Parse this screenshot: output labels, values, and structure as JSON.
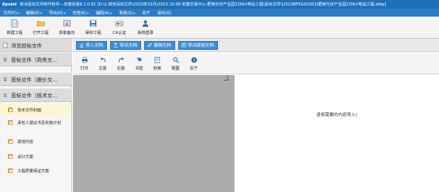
{
  "window": {
    "logo": "Epoint",
    "title": "新点投标文件制作软件---安徽省版6.2.0.61   [D:\\1.商务投标文件\\2023年10月\\2023.10.08-安徽交易中心-肥西光伏产业园220kV电站工程\\投标文件\\[2023BFEG01953]肥西光伏产业园220kV电站工程.etbp]"
  },
  "menu": {
    "items": [
      {
        "label": "文件(F)",
        "has_arrow": true
      },
      {
        "label": "编辑(E)",
        "has_arrow": true
      },
      {
        "label": "导出(O)",
        "has_arrow": true
      },
      {
        "label": "检查(K)",
        "has_arrow": true
      },
      {
        "label": "辅助(A)",
        "has_arrow": true
      },
      {
        "label": "系统(S)",
        "has_arrow": true
      },
      {
        "label": "关于",
        "has_arrow": false
      },
      {
        "label": "退出(Q)",
        "has_arrow": false
      }
    ]
  },
  "toolbar": {
    "buttons": [
      {
        "label": "新建工程",
        "icon": "new-project-icon"
      },
      {
        "label": "打开工程",
        "icon": "open-project-icon"
      },
      {
        "label": "获取备份",
        "icon": "get-backup-icon"
      },
      {
        "label": "保存工程",
        "icon": "save-project-icon"
      },
      {
        "label": "CA认证",
        "icon": "ca-certificate-icon"
      },
      {
        "label": "系统登录",
        "icon": "system-login-icon"
      }
    ]
  },
  "left_panel": {
    "sections": [
      {
        "label": "浏览招标文件"
      },
      {
        "label": "投标文件（商务文..."
      },
      {
        "label": "投标文件（报价文..."
      },
      {
        "label": "投标文件（技术文..."
      }
    ],
    "tech_items": [
      {
        "label": "技术文件封面",
        "active": true
      },
      {
        "label": "承包人建议书及实施计划",
        "active": false
      },
      {
        "label": "其他内容",
        "active": false
      },
      {
        "label": "设计方案",
        "active": false
      },
      {
        "label": "工程质量保证方案",
        "active": false
      }
    ]
  },
  "action_bar": {
    "buttons": [
      {
        "label": "导入文档",
        "icon": "import-icon"
      },
      {
        "label": "导出文档",
        "icon": "export-icon"
      },
      {
        "label": "编辑文档",
        "icon": "edit-icon"
      },
      {
        "label": "导出原始文档",
        "icon": "export-original-icon"
      }
    ]
  },
  "doc_toolbar": {
    "buttons": [
      {
        "label": "打印",
        "icon": "print-icon"
      },
      {
        "label": "左旋",
        "icon": "rotate-left-icon"
      },
      {
        "label": "右旋",
        "icon": "rotate-right-icon"
      },
      {
        "label": "书签",
        "icon": "bookmark-icon"
      },
      {
        "label": "检索",
        "icon": "search-icon"
      },
      {
        "label": "概图",
        "icon": "zoom-icon"
      },
      {
        "label": "关于",
        "icon": "info-icon"
      }
    ]
  },
  "document": {
    "message": "请将需要的内容导入!"
  },
  "colors": {
    "title_bar": "#1f6fb8",
    "menu_bar": "#2b7cc7",
    "action_button": "#3d8fd8",
    "item_square": "#e99a42",
    "active_item": "#fbf6d3",
    "doc_background": "#ababab"
  }
}
